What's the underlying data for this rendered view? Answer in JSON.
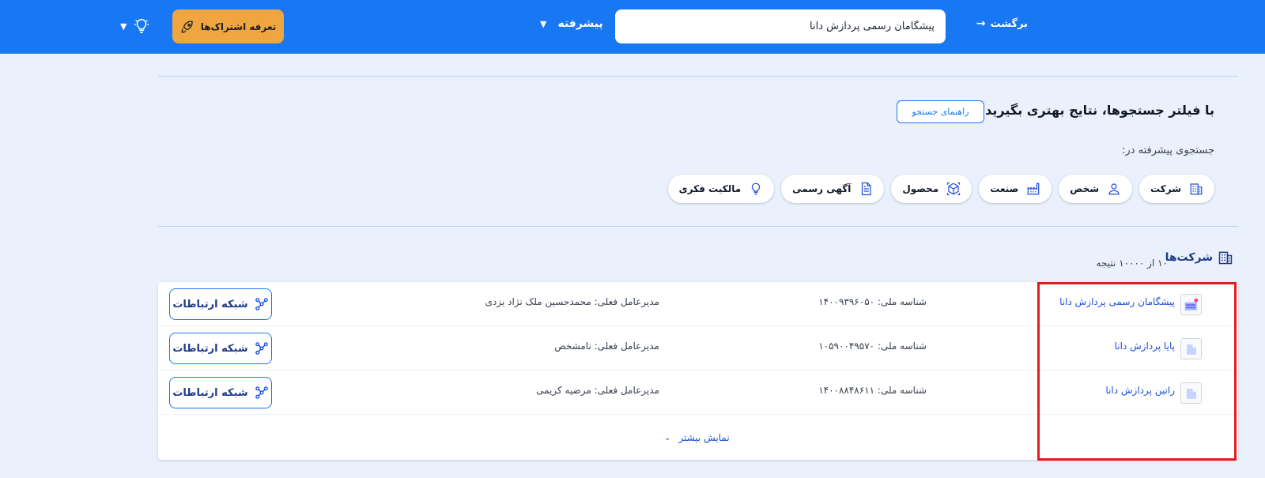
{
  "header": {
    "back_label": "برگشت",
    "search_value": "پیشگامان رسمی پردازش دانا",
    "advanced_label": "پیشرفته",
    "subscription_label": "تعرفه اشتراک‌ها"
  },
  "filter": {
    "title": "با فیلتر جستجوها، نتایج بهتری بگیرید",
    "guide_label": "راهنمای جستجو",
    "advanced_in_label": "جستجوی پیشرفته در:",
    "categories": [
      {
        "label": "شرکت",
        "icon": "building-icon"
      },
      {
        "label": "شخص",
        "icon": "person-icon"
      },
      {
        "label": "صنعت",
        "icon": "factory-icon"
      },
      {
        "label": "محصول",
        "icon": "product-box-icon"
      },
      {
        "label": "آگهی رسمی",
        "icon": "document-icon"
      },
      {
        "label": "مالکیت فکری",
        "icon": "lightbulb-icon"
      }
    ]
  },
  "results": {
    "section_title": "شرکت‌ها",
    "count_text": "۱۰ از ۱۰۰۰۰ نتیجه",
    "network_label": "شبکه ارتباطات",
    "show_more_label": "نمایش بیشتر",
    "rows": [
      {
        "name": "پیشگامان رسمی پردازش دانا",
        "national_id": "شناسه ملی: ۱۴۰۰۹۳۹۶۰۵۰",
        "ceo": "مدیرعامل فعلی: محمدحسین ملک نژاد یزدی"
      },
      {
        "name": "پایا پردازش دانا",
        "national_id": "شناسه ملی: ۱۰۵۹۰۰۴۹۵۷۰",
        "ceo": "مدیرعامل فعلی: نامشخص"
      },
      {
        "name": "راتین پردازش دانا",
        "national_id": "شناسه ملی: ۱۴۰۰۸۸۴۸۶۱۱",
        "ceo": "مدیرعامل فعلی: مرضیه کریمی"
      }
    ]
  },
  "colors": {
    "header_bg": "#1877f2",
    "subscription_bg": "#f0a640",
    "link": "#1d4ed8",
    "highlight_border": "#e11d1d"
  }
}
